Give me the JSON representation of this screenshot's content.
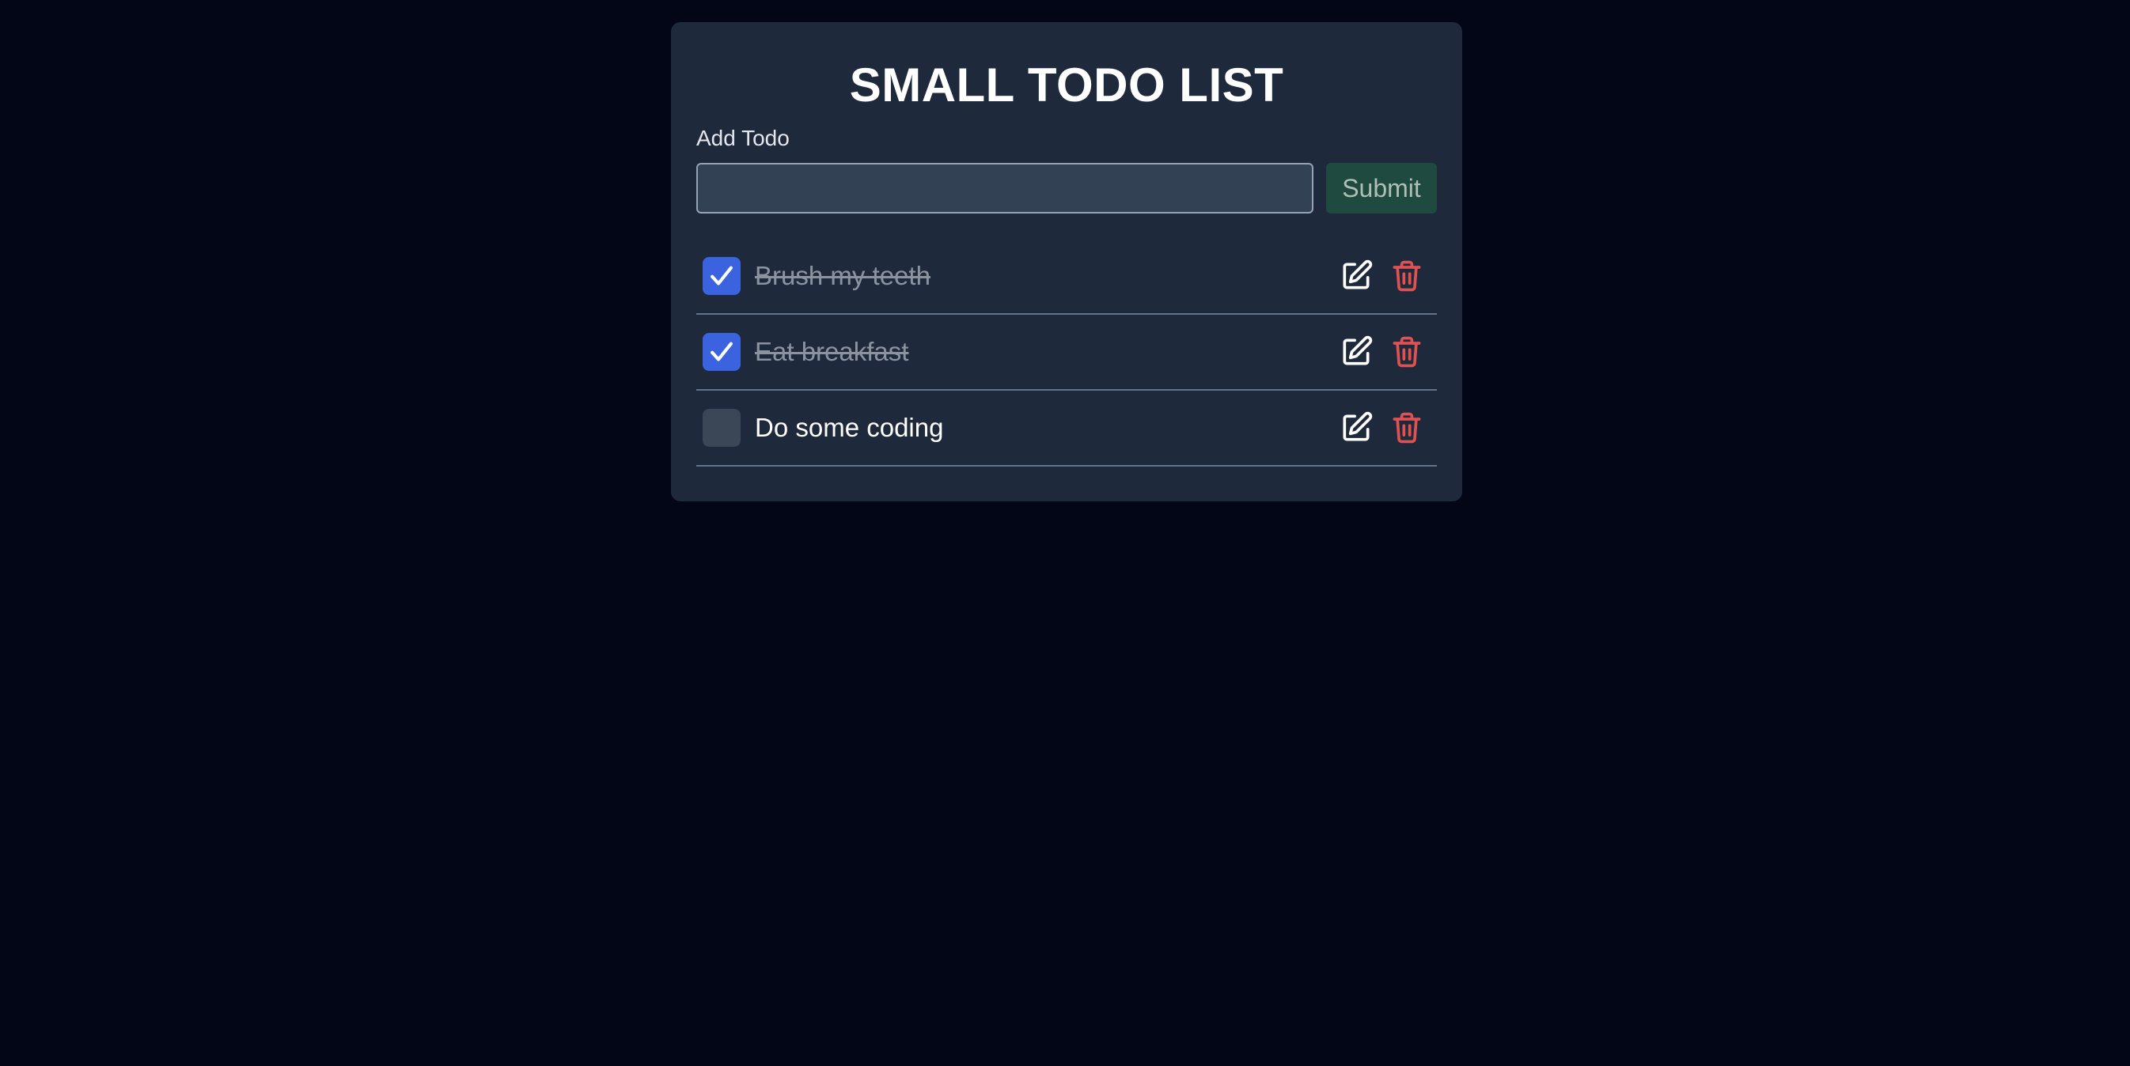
{
  "app": {
    "title": "SMALL TODO LIST"
  },
  "form": {
    "label": "Add Todo",
    "input_value": "",
    "input_placeholder": "",
    "submit_label": "Submit"
  },
  "todos": [
    {
      "text": "Brush my teeth",
      "completed": true
    },
    {
      "text": "Eat breakfast",
      "completed": true
    },
    {
      "text": "Do some coding",
      "completed": false
    }
  ],
  "icons": {
    "checkbox": "check-icon",
    "edit": "edit-icon",
    "delete": "trash-icon"
  },
  "colors": {
    "page_background": "#020617",
    "card_background": "#1e293b",
    "checkbox_checked": "#3b63e0",
    "checkbox_unchecked": "#3b4657",
    "submit_background": "#1f4a40",
    "delete_icon": "#e05252",
    "completed_text": "#8b93a0"
  }
}
